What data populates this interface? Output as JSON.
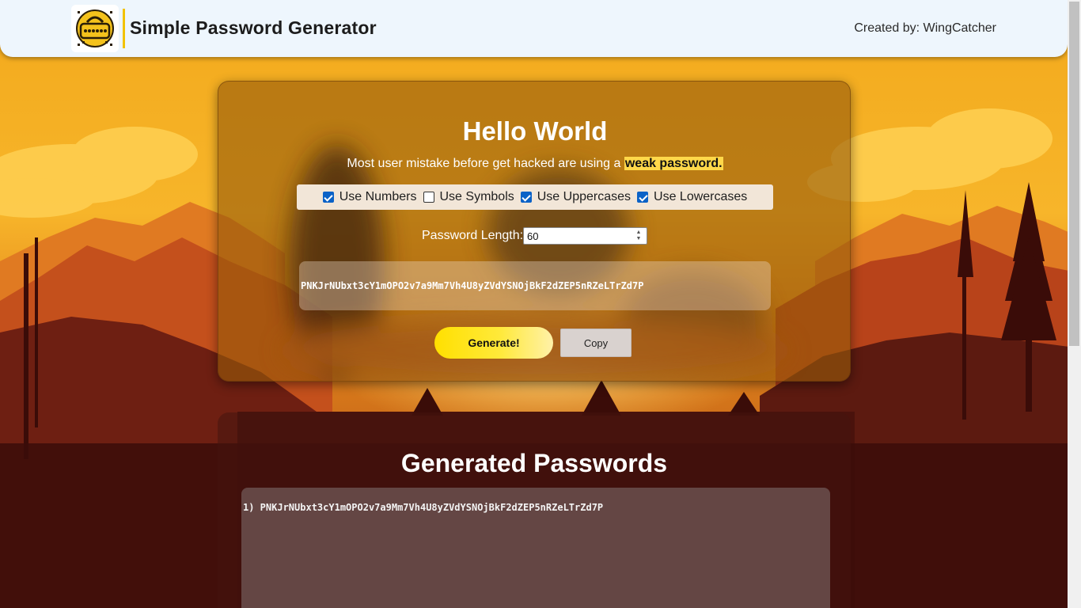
{
  "header": {
    "title": "Simple Password Generator",
    "credit": "Created by: WingCatcher",
    "logo_icon": "password-lock-icon"
  },
  "generator": {
    "heading": "Hello World",
    "tagline_prefix": "Most user mistake before get hacked are using a",
    "tagline_highlight": "weak password.",
    "options": [
      {
        "label": "Use Numbers",
        "checked": true
      },
      {
        "label": "Use Symbols",
        "checked": false
      },
      {
        "label": "Use Uppercases",
        "checked": true
      },
      {
        "label": "Use Lowercases",
        "checked": true
      }
    ],
    "length_label": "Password Length:",
    "length_value": "60",
    "output": "PNKJrNUbxt3cY1mOPO2v7a9Mm7Vh4U8yZVdYSNOjBkF2dZEP5nRZeLTrZd7P",
    "generate_label": "Generate!",
    "copy_label": "Copy"
  },
  "history": {
    "title": "Generated Passwords",
    "entries": [
      "1) PNKJrNUbxt3cY1mOPO2v7a9Mm7Vh4U8yZVdYSNOjBkF2dZEP5nRZeLTrZd7P"
    ]
  },
  "colors": {
    "accent": "#f2c200",
    "header_bg": "#eef6fd",
    "checkbox_on": "#0b62c7",
    "generate_button": "#ffe000"
  }
}
